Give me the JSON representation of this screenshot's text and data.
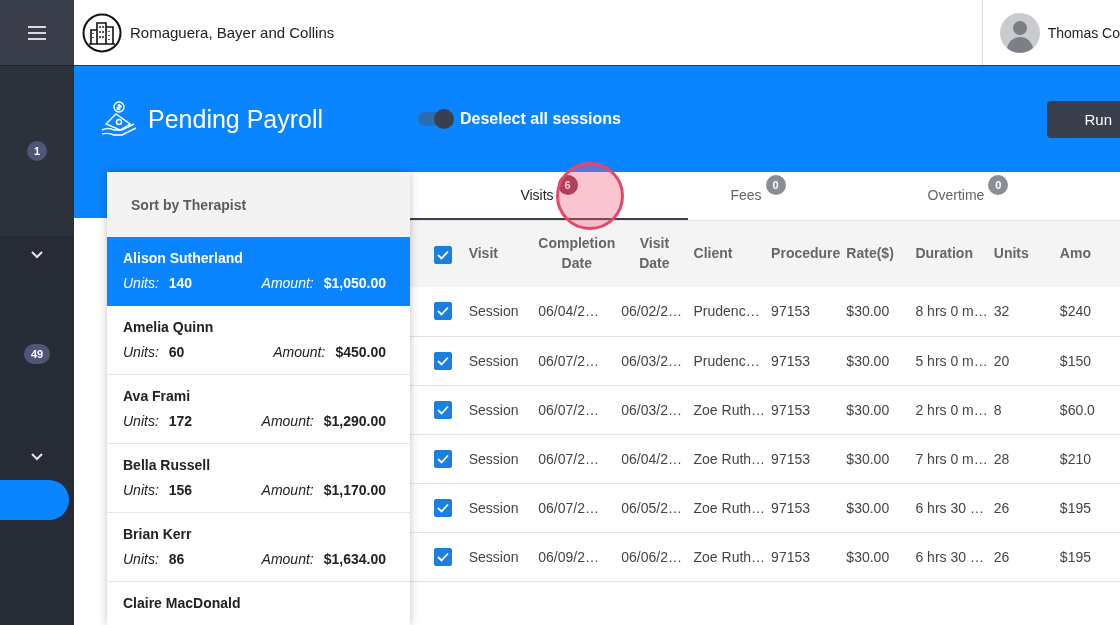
{
  "header": {
    "company": "Romaguera, Bayer and Collins",
    "user": "Thomas Co"
  },
  "sidebar": {
    "items": [
      {
        "kind": "badge",
        "text": "1"
      },
      {
        "kind": "chevron"
      },
      {
        "kind": "badge",
        "text": "49"
      },
      {
        "kind": "chevron"
      },
      {
        "kind": "pill",
        "selected": true
      }
    ]
  },
  "page": {
    "title": "Pending Payroll",
    "toggle": {
      "label": "Deselect all sessions",
      "on": true
    },
    "action": "Run"
  },
  "therapists": {
    "heading": "Sort by Therapist",
    "items": [
      {
        "name": "Alison Sutherland",
        "units_label": "Units:",
        "units": "140",
        "amount_label": "Amount:",
        "amount": "$1,050.00",
        "selected": true
      },
      {
        "name": "Amelia Quinn",
        "units_label": "Units:",
        "units": "60",
        "amount_label": "Amount:",
        "amount": "$450.00",
        "selected": false
      },
      {
        "name": "Ava Frami",
        "units_label": "Units:",
        "units": "172",
        "amount_label": "Amount:",
        "amount": "$1,290.00",
        "selected": false
      },
      {
        "name": "Bella Russell",
        "units_label": "Units:",
        "units": "156",
        "amount_label": "Amount:",
        "amount": "$1,170.00",
        "selected": false
      },
      {
        "name": "Brian Kerr",
        "units_label": "Units:",
        "units": "86",
        "amount_label": "Amount:",
        "amount": "$1,634.00",
        "selected": false
      },
      {
        "name": "Claire MacDonald",
        "selected": false
      }
    ]
  },
  "tabs": [
    {
      "label": "Visits",
      "count": "6",
      "selected": true
    },
    {
      "label": "Fees",
      "count": "0",
      "selected": false
    },
    {
      "label": "Overtime",
      "count": "0",
      "selected": false
    }
  ],
  "table": {
    "all_checked": true,
    "columns": [
      "Visit",
      "Completion Date",
      "Visit Date",
      "Client",
      "Procedure",
      "Rate($)",
      "Duration",
      "Units",
      "Amo"
    ],
    "rows": [
      {
        "checked": true,
        "cells": [
          "Session",
          "06/04/2…",
          "06/02/2…",
          "Prudenc…",
          "97153",
          "$30.00",
          "8 hrs 0 m…",
          "32",
          "$240"
        ]
      },
      {
        "checked": true,
        "cells": [
          "Session",
          "06/07/2…",
          "06/03/2…",
          "Prudenc…",
          "97153",
          "$30.00",
          "5 hrs 0 m…",
          "20",
          "$150"
        ]
      },
      {
        "checked": true,
        "cells": [
          "Session",
          "06/07/2…",
          "06/03/2…",
          "Zoe Ruth…",
          "97153",
          "$30.00",
          "2 hrs 0 m…",
          "8",
          "$60.0"
        ]
      },
      {
        "checked": true,
        "cells": [
          "Session",
          "06/07/2…",
          "06/04/2…",
          "Zoe Ruth…",
          "97153",
          "$30.00",
          "7 hrs 0 m…",
          "28",
          "$210"
        ]
      },
      {
        "checked": true,
        "cells": [
          "Session",
          "06/07/2…",
          "06/05/2…",
          "Zoe Ruth…",
          "97153",
          "$30.00",
          "6 hrs 30 …",
          "26",
          "$195"
        ]
      },
      {
        "checked": true,
        "cells": [
          "Session",
          "06/09/2…",
          "06/06/2…",
          "Zoe Ruth…",
          "97153",
          "$30.00",
          "6 hrs 30 …",
          "26",
          "$195"
        ]
      }
    ]
  }
}
